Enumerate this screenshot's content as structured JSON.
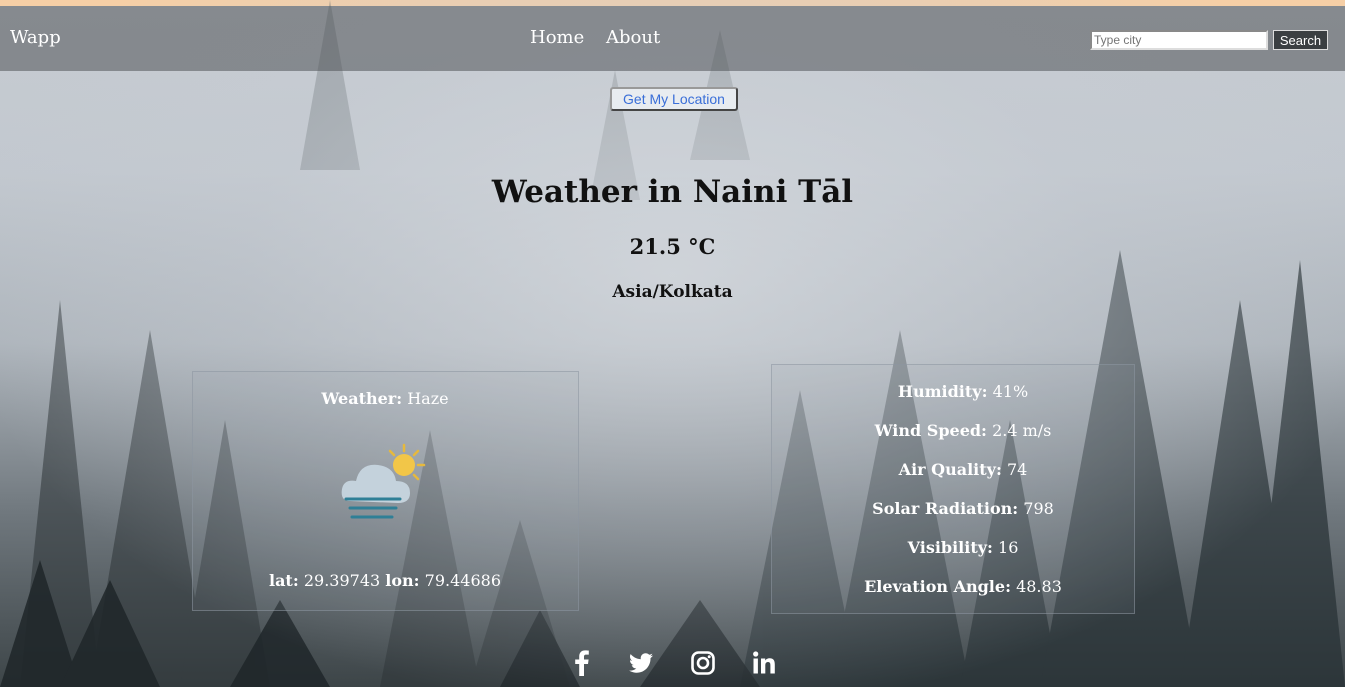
{
  "navbar": {
    "brand": "Wapp",
    "links": [
      {
        "label": "Home"
      },
      {
        "label": "About"
      }
    ],
    "search": {
      "placeholder": "Type city",
      "value": "",
      "button": "Search"
    }
  },
  "location_button": "Get My Location",
  "weather": {
    "title": "Weather in Naini Tāl",
    "temperature": "21.5 °C",
    "timezone": "Asia/Kolkata",
    "condition_label": "Weather:",
    "condition": "Haze",
    "icon": "haze-cloud-sun-icon",
    "lat_label": "lat:",
    "lat": "29.39743",
    "lon_label": "lon:",
    "lon": "79.44686"
  },
  "stats": [
    {
      "label": "Humidity:",
      "value": "41%"
    },
    {
      "label": "Wind Speed:",
      "value": "2.4 m/s"
    },
    {
      "label": "Air Quality:",
      "value": "74"
    },
    {
      "label": "Solar Radiation:",
      "value": "798"
    },
    {
      "label": "Visibility:",
      "value": "16"
    },
    {
      "label": "Elevation Angle:",
      "value": "48.83"
    }
  ],
  "social_icons": [
    "facebook-icon",
    "twitter-icon",
    "instagram-icon",
    "linkedin-icon"
  ],
  "colors": {
    "top_stripe": "#f6cfa6",
    "link_blue": "#3a6fd8",
    "navbar": "#505458"
  }
}
